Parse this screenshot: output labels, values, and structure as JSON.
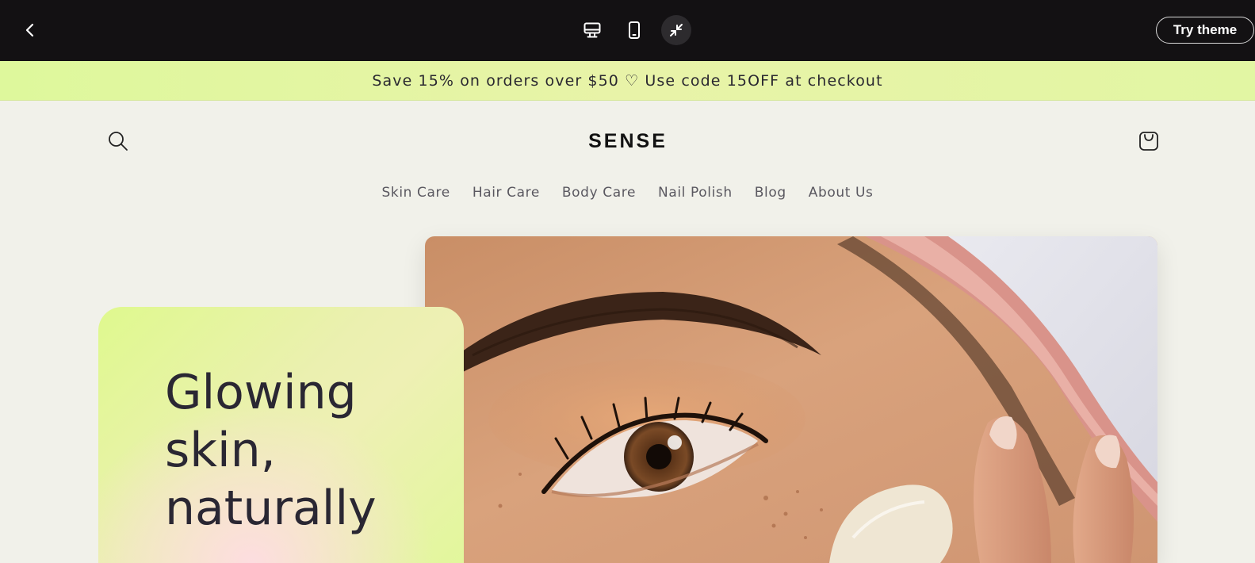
{
  "preview_bar": {
    "back_icon": "chevron-left-icon",
    "device_icons": [
      "desktop-icon",
      "mobile-icon",
      "collapse-icon"
    ],
    "try_theme_label": "Try theme"
  },
  "announcement": {
    "text": "Save 15% on orders over $50 ♡ Use code 15OFF at checkout"
  },
  "header": {
    "logo": "SENSE",
    "search_icon": "search-icon",
    "cart_icon": "cart-icon"
  },
  "nav": {
    "items": [
      "Skin Care",
      "Hair Care",
      "Body Care",
      "Nail Polish",
      "Blog",
      "About Us"
    ]
  },
  "hero": {
    "title": "Glowing\nskin,\nnaturally"
  },
  "colors": {
    "topbar": "#131113",
    "page_background": "#f1f1ea",
    "announcement_bg": "#e2f6a3",
    "card_green": "#dff98e",
    "card_pink": "#fddde0",
    "text_dark": "#2a2733"
  }
}
